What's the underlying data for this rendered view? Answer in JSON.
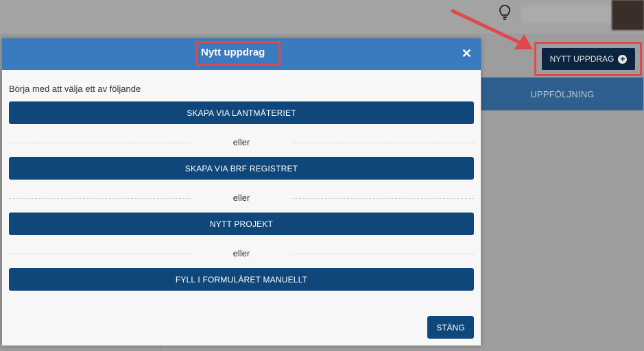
{
  "background": {
    "new_assignment_button": "NYTT UPPDRAG",
    "tab_label": "UPPFÖLJNING"
  },
  "modal": {
    "title": "Nytt uppdrag",
    "intro": "Börja med att välja ett av följande",
    "options": [
      "SKAPA VIA LANTMÄTERIET",
      "SKAPA VIA BRF REGISTRET",
      "NYTT PROJEKT",
      "FYLL I FORMULÄRET MANUELLT"
    ],
    "separator": "eller",
    "close_label": "STÄNG"
  },
  "colors": {
    "header": "#3a7bbf",
    "button": "#0f477b",
    "highlight": "#e0484a"
  }
}
